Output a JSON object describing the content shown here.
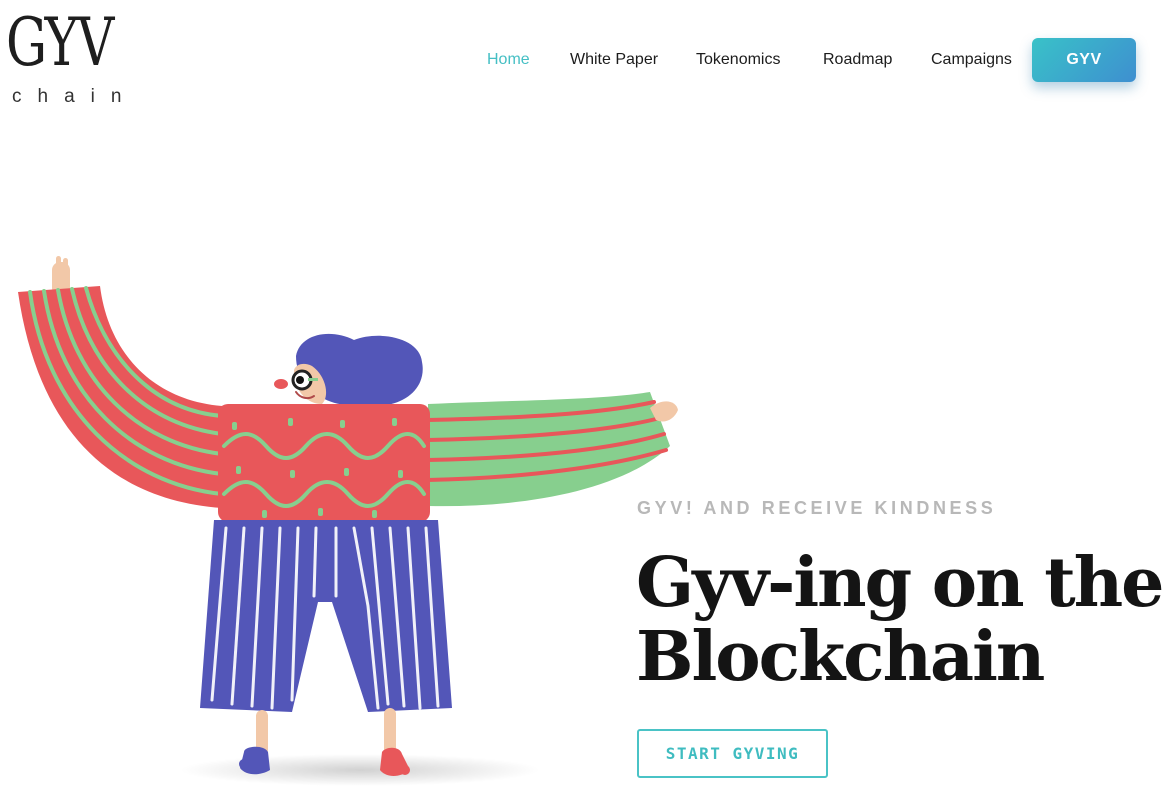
{
  "logo": {
    "main": "GYV",
    "sub": "chain"
  },
  "nav": {
    "items": [
      {
        "label": "Home",
        "active": true
      },
      {
        "label": "White Paper",
        "active": false
      },
      {
        "label": "Tokenomics",
        "active": false
      },
      {
        "label": "Roadmap",
        "active": false
      },
      {
        "label": "Campaigns",
        "active": false
      }
    ],
    "cta_label": "GYV"
  },
  "hero": {
    "eyebrow": "GYV! AND RECEIVE KINDNESS",
    "headline": "Gyv-ing on the Blockchain",
    "button_label": "START GYVING"
  },
  "colors": {
    "accent": "#45bfc4",
    "cta_gradient_start": "#39c2c8",
    "cta_gradient_end": "#3e8fd0",
    "sweater_red": "#e8575a",
    "sleeve_green": "#87cf8e",
    "pants_blue": "#5356b8",
    "headline": "#141414",
    "eyebrow": "#b8b8b8"
  },
  "illustration": {
    "name": "clay-figure-with-open-arms"
  }
}
